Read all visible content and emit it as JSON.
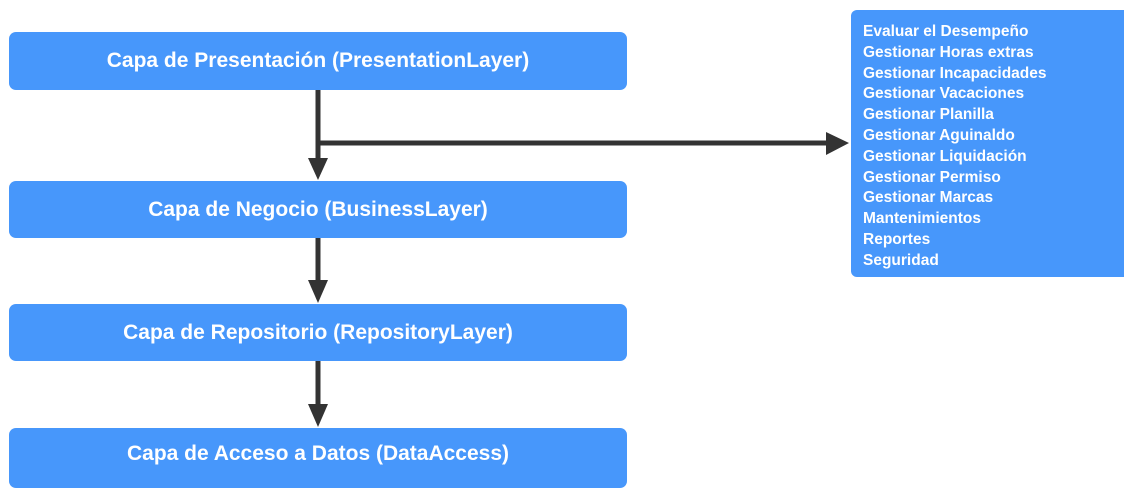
{
  "layers": {
    "presentation": "Capa de Presentación (PresentationLayer)",
    "business": "Capa de Negocio (BusinessLayer)",
    "repository": "Capa de Repositorio (RepositoryLayer)",
    "data_access": "Capa de Acceso a Datos (DataAccess)"
  },
  "modules": [
    "Evaluar el Desempeño",
    "Gestionar Horas extras",
    "Gestionar Incapacidades",
    "Gestionar Vacaciones",
    "Gestionar Planilla",
    "Gestionar Aguinaldo",
    "Gestionar Liquidación",
    "Gestionar Permiso",
    "Gestionar Marcas",
    "Mantenimientos",
    "Reportes",
    "Seguridad"
  ],
  "colors": {
    "box_fill": "#4797fb",
    "box_text": "#ffffff",
    "connector": "#333333"
  }
}
